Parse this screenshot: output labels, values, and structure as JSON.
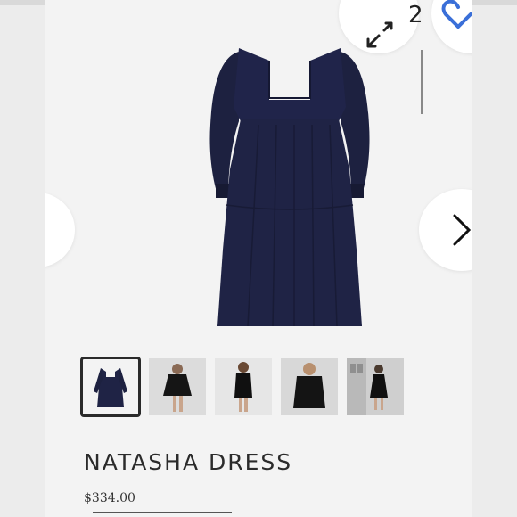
{
  "product": {
    "title": "NATASHA DRESS",
    "price": "$334.00"
  },
  "gallery": {
    "image_count": "2",
    "thumbnails": [
      {
        "name": "thumb-1",
        "selected": true
      },
      {
        "name": "thumb-2",
        "selected": false
      },
      {
        "name": "thumb-3",
        "selected": false
      },
      {
        "name": "thumb-4",
        "selected": false
      },
      {
        "name": "thumb-5",
        "selected": false
      }
    ]
  },
  "icons": {
    "expand": "expand-arrows-icon",
    "favorite": "heart-icon",
    "next": "chevron-right-icon",
    "prev": "chevron-left-icon"
  },
  "colors": {
    "dress": "#1e2240",
    "accent": "#3a6fd8",
    "background": "#f3f3f3"
  }
}
